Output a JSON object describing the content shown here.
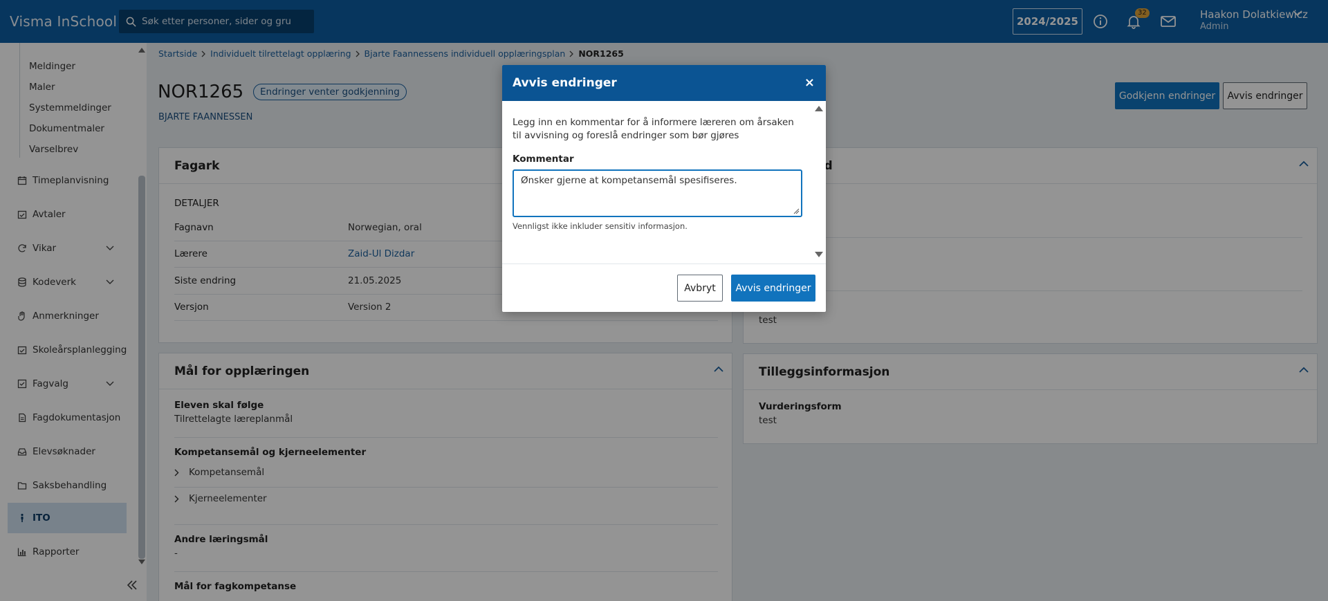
{
  "header": {
    "app_title": "Visma InSchool",
    "search_placeholder": "Søk etter personer, sider og gru",
    "school_year": "2024/2025",
    "notification_count": "32",
    "user_name": "Haakon Dolatkiewicz",
    "user_role": "Admin"
  },
  "sidebar": {
    "sub_items": [
      "Meldinger",
      "Maler",
      "Systemmeldinger",
      "Dokumentmaler",
      "Varselbrev"
    ],
    "items": [
      {
        "label": "Timeplanvisning",
        "icon": "calendar-icon"
      },
      {
        "label": "Avtaler",
        "icon": "calendar-check-icon"
      },
      {
        "label": "Vikar",
        "icon": "refresh-icon"
      },
      {
        "label": "Kodeverk",
        "icon": "database-icon"
      },
      {
        "label": "Anmerkninger",
        "icon": "hand-icon"
      },
      {
        "label": "Skoleårsplanlegging",
        "icon": "calendar-check-icon"
      },
      {
        "label": "Fagvalg",
        "icon": "checklist-icon"
      },
      {
        "label": "Fagdokumentasjon",
        "icon": "document-icon"
      },
      {
        "label": "Elevsøknader",
        "icon": "inbox-icon"
      },
      {
        "label": "Saksbehandling",
        "icon": "folder-icon"
      },
      {
        "label": "ITO",
        "icon": "person-icon"
      },
      {
        "label": "Rapporter",
        "icon": "bar-chart-icon"
      }
    ]
  },
  "breadcrumbs": [
    "Startside",
    "Individuelt tilrettelagt opplæring",
    "Bjarte Faannessens individuell opplæringsplan",
    "NOR1265"
  ],
  "page": {
    "title": "NOR1265",
    "status_badge": "Endringer venter godkjenning",
    "student_name": "BJARTE FAANNESSEN",
    "approve_button": "Godkjenn endringer",
    "reject_button": "Avvis endringer"
  },
  "fagark": {
    "title": "Fagark",
    "section": "DETALJER",
    "rows": [
      {
        "label": "Fagnavn",
        "value": "Norwegian, oral"
      },
      {
        "label": "Lærere",
        "value": "Zaid-Ul Dizdar"
      },
      {
        "label": "Siste endring",
        "value": "21.05.2025"
      },
      {
        "label": "Versjon",
        "value": "Version 2"
      }
    ]
  },
  "right_card": {
    "title_partial": "old",
    "value": "test"
  },
  "maal": {
    "title": "Mål for opplæringen",
    "follow_label": "Eleven skal følge",
    "follow_value": "Tilrettelagte læreplanmål",
    "komp_label": "Kompetansemål og kjerneelementer",
    "kompetansemaal": "Kompetansemål",
    "kjerneelementer": "Kjerneelementer",
    "andre_label": "Andre læringsmål",
    "andre_value": "-",
    "fagkomp_label": "Mål for fagkompetanse"
  },
  "tillegg": {
    "title": "Tilleggsinformasjon",
    "label": "Vurderingsform",
    "value": "test"
  },
  "modal": {
    "title": "Avvis endringer",
    "close": "×",
    "intro": "Legg inn en kommentar for å informere læreren om årsaken til avvisning og foreslå endringer som bør gjøres",
    "comment_label": "Kommentar",
    "comment_value": "Ønsker gjerne at kompetansemål spesifiseres.",
    "help_text": "Vennligst ikke inkluder sensitiv informasjon.",
    "cancel_button": "Avbryt",
    "confirm_button": "Avvis endringer"
  }
}
